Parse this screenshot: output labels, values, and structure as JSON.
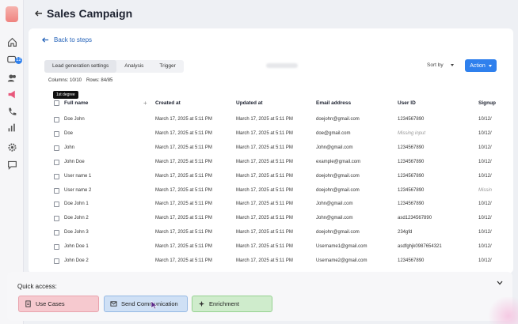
{
  "header": {
    "title": "Sales Campaign"
  },
  "back_link": "Back to steps",
  "tabs": [
    "Lead generation settings",
    "Analysis",
    "Trigger"
  ],
  "sort_label": "Sort by",
  "action_label": "Action",
  "columns_info": "Columns: 10/10",
  "rows_info": "Rows: 84/85",
  "tooltip": "1st degree",
  "sidebar": {
    "badge": "12"
  },
  "table": {
    "headers": [
      "Full name",
      "Created at",
      "Updated at",
      "Email address",
      "User ID",
      "Signup"
    ],
    "rows": [
      {
        "name": "Doe John",
        "created": "March 17, 2025 at 5:11 PM",
        "updated": "March 17, 2025 at 5:11 PM",
        "email": "doejohn@gmail.com",
        "uid": "1234567890",
        "signup": "10/12/"
      },
      {
        "name": "Doe",
        "created": "March 17, 2025 at 5:11 PM",
        "updated": "March 17, 2025 at 5:11 PM",
        "email": "doe@gmail.com",
        "uid": "Missing input",
        "signup": "10/12/"
      },
      {
        "name": "John",
        "created": "March 17, 2025 at 5:11 PM",
        "updated": "March 17, 2025 at 5:11 PM",
        "email": "John@gmail.com",
        "uid": "1234567890",
        "signup": "10/12/"
      },
      {
        "name": "John Doe",
        "created": "March 17, 2025 at 5:11 PM",
        "updated": "March 17, 2025 at 5:11 PM",
        "email": "example@gmail.com",
        "uid": "1234567890",
        "signup": "10/12/"
      },
      {
        "name": "User name 1",
        "created": "March 17, 2025 at 5:11 PM",
        "updated": "March 17, 2025 at 5:11 PM",
        "email": "doejohn@gmail.com",
        "uid": "1234567890",
        "signup": "10/12/"
      },
      {
        "name": "User name 2",
        "created": "March 17, 2025 at 5:11 PM",
        "updated": "March 17, 2025 at 5:11 PM",
        "email": "doejohn@gmail.com",
        "uid": "1234567890",
        "signup": "Missin"
      },
      {
        "name": "Doe John 1",
        "created": "March 17, 2025 at 5:11 PM",
        "updated": "March 17, 2025 at 5:11 PM",
        "email": "John@gmail.com",
        "uid": "1234567890",
        "signup": "10/12/"
      },
      {
        "name": "Doe John 2",
        "created": "March 17, 2025 at 5:11 PM",
        "updated": "March 17, 2025 at 5:11 PM",
        "email": "John@gmail.com",
        "uid": "asd1234567890",
        "signup": "10/12/"
      },
      {
        "name": "Doe John 3",
        "created": "March 17, 2025 at 5:11 PM",
        "updated": "March 17, 2025 at 5:11 PM",
        "email": "doejohn@gmail.com",
        "uid": "234gfd",
        "signup": "10/12/"
      },
      {
        "name": "John Doe 1",
        "created": "March 17, 2025 at 5:11 PM",
        "updated": "March 17, 2025 at 5:11 PM",
        "email": "Username1@gmail.com",
        "uid": "asdfghjk0987654321",
        "signup": "10/12/"
      },
      {
        "name": "John Doe 2",
        "created": "March 17, 2025 at 5:11 PM",
        "updated": "March 17, 2025 at 5:11 PM",
        "email": "Username2@gmail.com",
        "uid": "1234567890",
        "signup": "10/12/"
      }
    ]
  },
  "quick_access": {
    "title": "Quick access:",
    "buttons": [
      "Use Cases",
      "Send Communication",
      "Enrichment"
    ]
  },
  "colors": {
    "accent": "#2f80ed",
    "link": "#2563b9"
  }
}
